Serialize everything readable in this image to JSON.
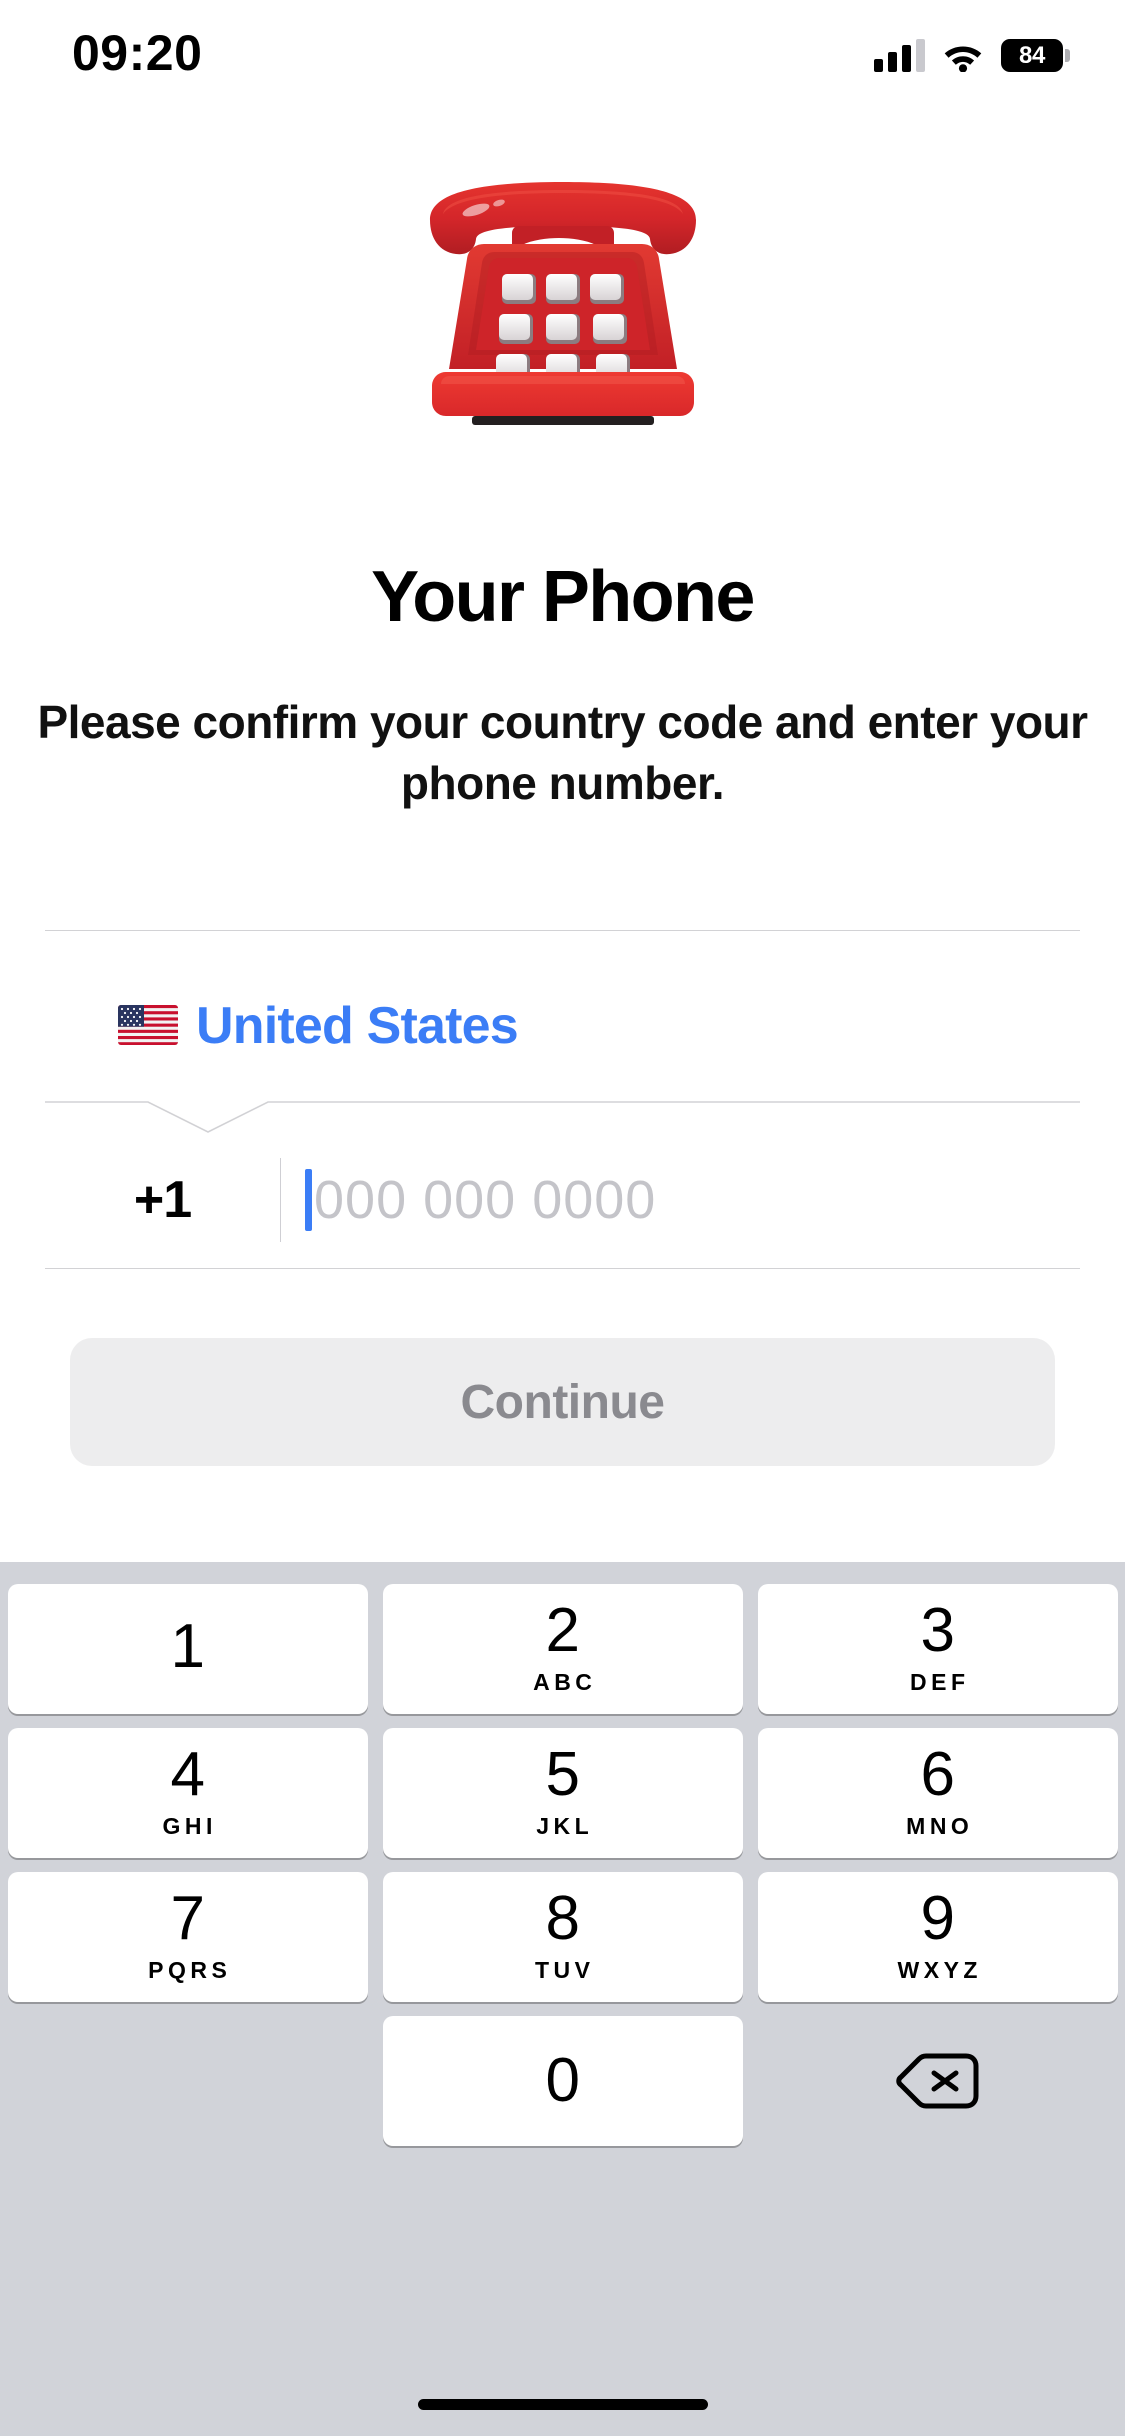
{
  "status_bar": {
    "time": "09:20",
    "battery_level": "84",
    "signal_icon": "cellular-bars-icon",
    "wifi_icon": "wifi-icon",
    "battery_icon": "battery-icon"
  },
  "hero": {
    "emoji_name": "telephone-emoji",
    "emoji_char": "☎️"
  },
  "page": {
    "title": "Your Phone",
    "subtitle": "Please confirm your country code and enter your phone number."
  },
  "form": {
    "country": {
      "flag_name": "flag-united-states-icon",
      "name": "United States",
      "accent_color": "#3B7DF6"
    },
    "country_code": "+1",
    "phone_placeholder": "000 000 0000",
    "phone_value": ""
  },
  "continue_button": {
    "label": "Continue",
    "enabled": false,
    "background": "#EDEDEE",
    "text_color": "#8A8A8F"
  },
  "keypad": {
    "background": "#D1D3D9",
    "rows": [
      [
        {
          "digit": "1",
          "letters": ""
        },
        {
          "digit": "2",
          "letters": "ABC"
        },
        {
          "digit": "3",
          "letters": "DEF"
        }
      ],
      [
        {
          "digit": "4",
          "letters": "GHI"
        },
        {
          "digit": "5",
          "letters": "JKL"
        },
        {
          "digit": "6",
          "letters": "MNO"
        }
      ],
      [
        {
          "digit": "7",
          "letters": "PQRS"
        },
        {
          "digit": "8",
          "letters": "TUV"
        },
        {
          "digit": "9",
          "letters": "WXYZ"
        }
      ],
      [
        {
          "digit": "0",
          "letters": ""
        }
      ]
    ],
    "backspace_icon": "backspace-delete-icon"
  },
  "home_indicator": {
    "name": "home-indicator"
  }
}
